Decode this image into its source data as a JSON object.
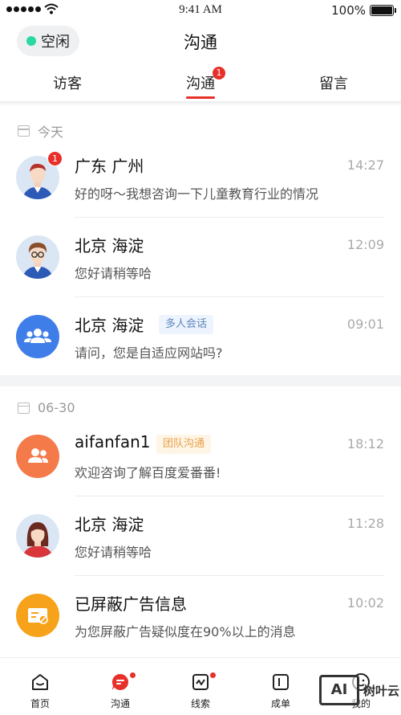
{
  "status_bar": {
    "time": "9:41 AM",
    "battery": "100%"
  },
  "header": {
    "status_label": "空闲",
    "title": "沟通"
  },
  "tabs": [
    {
      "label": "访客"
    },
    {
      "label": "沟通",
      "badge": "1",
      "active": true
    },
    {
      "label": "留言"
    }
  ],
  "sections": [
    {
      "date": "今天",
      "conversations": [
        {
          "name": "广东 广州",
          "time": "14:27",
          "message": "好的呀～我想咨询一下儿童教育行业的情况",
          "badge": "1",
          "avatar": "man-avatar"
        },
        {
          "name": "北京 海淀",
          "time": "12:09",
          "message": "您好请稍等哈",
          "avatar": "man-glasses-avatar"
        },
        {
          "name": "北京 海淀",
          "time": "09:01",
          "message": "请问，您是自适应网站吗?",
          "tag": "多人会话",
          "avatar": "group-icon"
        }
      ]
    },
    {
      "date": "06-30",
      "conversations": [
        {
          "name": "aifanfan1",
          "time": "18:12",
          "message": "欢迎咨询了解百度爱番番!",
          "tag": "团队沟通",
          "avatar": "team-icon"
        },
        {
          "name": "北京 海淀",
          "time": "11:28",
          "message": "您好请稍等哈",
          "avatar": "woman-avatar"
        },
        {
          "name": "已屏蔽广告信息",
          "time": "10:02",
          "message": "为您屏蔽广告疑似度在90%以上的消息",
          "avatar": "blocked-ad-icon"
        }
      ]
    }
  ],
  "bottom_nav": [
    {
      "label": "首页",
      "icon": "home-icon"
    },
    {
      "label": "沟通",
      "icon": "chat-icon",
      "active": true,
      "dot": true
    },
    {
      "label": "线索",
      "icon": "leads-icon",
      "dot": true
    },
    {
      "label": "成单",
      "icon": "deal-icon"
    },
    {
      "label": "我的",
      "icon": "profile-icon"
    }
  ],
  "watermark": {
    "logo": "AI",
    "text": "树叶云"
  },
  "colors": {
    "accent": "#e8302a",
    "online": "#2ad8a4",
    "blue": "#3f7ee8",
    "orange": "#f47a4a",
    "yellow": "#f7a21b"
  }
}
